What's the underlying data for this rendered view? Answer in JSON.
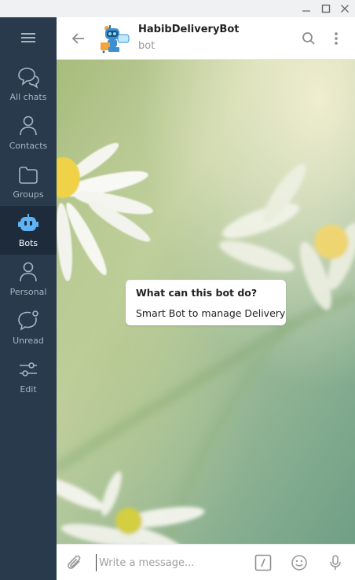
{
  "window": {
    "controls": [
      "minimize-icon",
      "maximize-icon",
      "close-icon"
    ]
  },
  "sidebar": {
    "menu_icon": "hamburger-menu-icon",
    "items": [
      {
        "label": "All chats",
        "icon": "chats-bubble-icon",
        "active": false
      },
      {
        "label": "Contacts",
        "icon": "person-icon",
        "active": false
      },
      {
        "label": "Groups",
        "icon": "folder-icon",
        "active": false
      },
      {
        "label": "Bots",
        "icon": "bot-icon",
        "active": true
      },
      {
        "label": "Personal",
        "icon": "person-icon",
        "active": false
      },
      {
        "label": "Unread",
        "icon": "unread-bubble-icon",
        "active": false
      },
      {
        "label": "Edit",
        "icon": "sliders-icon",
        "active": false
      }
    ]
  },
  "header": {
    "title": "HabibDeliveryBot",
    "status": "bot"
  },
  "bot_info": {
    "title": "What can this bot do?",
    "description": "Smart Bot to manage Delivery"
  },
  "composer": {
    "placeholder": "Write a message..."
  },
  "colors": {
    "sidebar_bg": "#293a4c",
    "sidebar_active_bg": "#1d2b3a",
    "sidebar_active_icon": "#5fb3f3",
    "sidebar_text": "#a7b4c2"
  }
}
